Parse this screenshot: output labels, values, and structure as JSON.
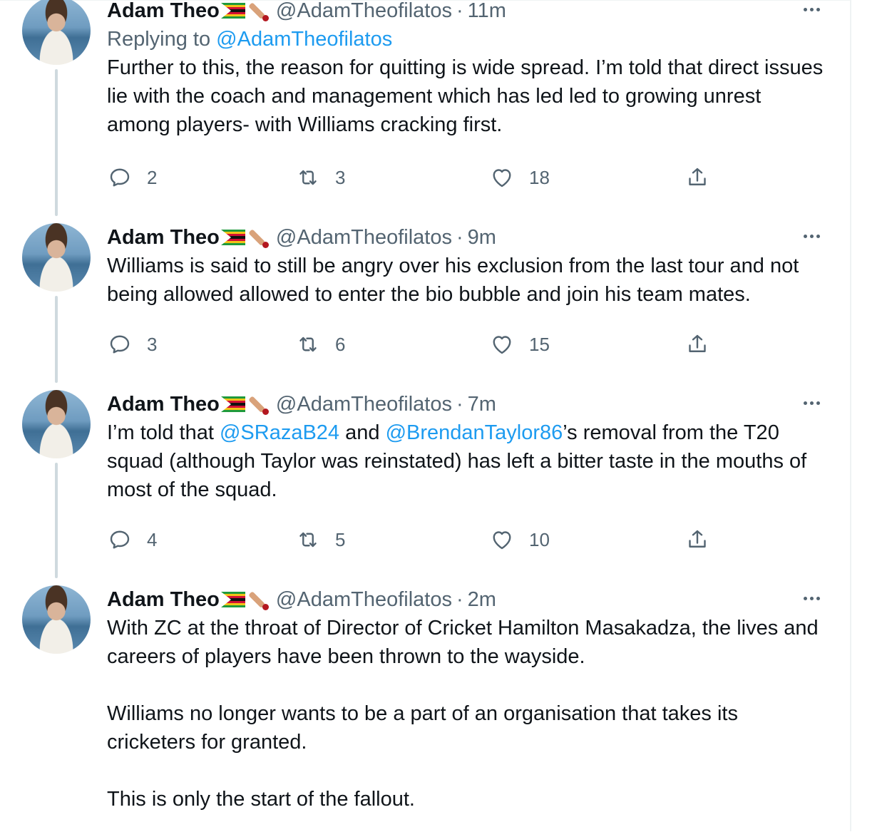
{
  "tweets": [
    {
      "name": "Adam Theo",
      "handle": "@AdamTheofilatos",
      "separator": "·",
      "time": "11m",
      "replying_prefix": "Replying to",
      "replying_handle": "@AdamTheofilatos",
      "text": "Further to this, the reason for quitting is wide spread. I’m told that direct issues lie with the coach and management which has led led to growing unrest among players- with Williams cracking first.",
      "replies": "2",
      "retweets": "3",
      "likes": "18"
    },
    {
      "name": "Adam Theo",
      "handle": "@AdamTheofilatos",
      "separator": "·",
      "time": "9m",
      "text": "Williams is said to still be angry over his exclusion from the last tour and not being allowed allowed to enter the bio bubble and join his team mates.",
      "replies": "3",
      "retweets": "6",
      "likes": "15"
    },
    {
      "name": "Adam Theo",
      "handle": "@AdamTheofilatos",
      "separator": "·",
      "time": "7m",
      "text_parts": {
        "t1": "I’m told that ",
        "m1": "@SRazaB24",
        "t2": " and ",
        "m2": "@BrendanTaylor86",
        "t3": "’s removal from the T20 squad (although Taylor was reinstated) has left a bitter taste in the mouths of most of the squad."
      },
      "replies": "4",
      "retweets": "5",
      "likes": "10"
    },
    {
      "name": "Adam Theo",
      "handle": "@AdamTheofilatos",
      "separator": "·",
      "time": "2m",
      "paragraphs": [
        "With ZC at the throat of Director of Cricket Hamilton Masakadza, the lives and careers of players have been thrown to the wayside.",
        "Williams no longer wants to be a part of an organisation that takes its cricketers for granted.",
        "This is only the start of the fallout."
      ]
    }
  ],
  "icons": {
    "reply": "reply-icon",
    "retweet": "retweet-icon",
    "like": "heart-icon",
    "share": "share-icon",
    "more": "more-icon",
    "flag": "zimbabwe-flag-emoji",
    "bat": "cricket-bat-emoji"
  },
  "colors": {
    "text": "#0f1419",
    "secondary": "#536471",
    "link": "#1d9bf0",
    "thread_line": "#cfd9de"
  }
}
